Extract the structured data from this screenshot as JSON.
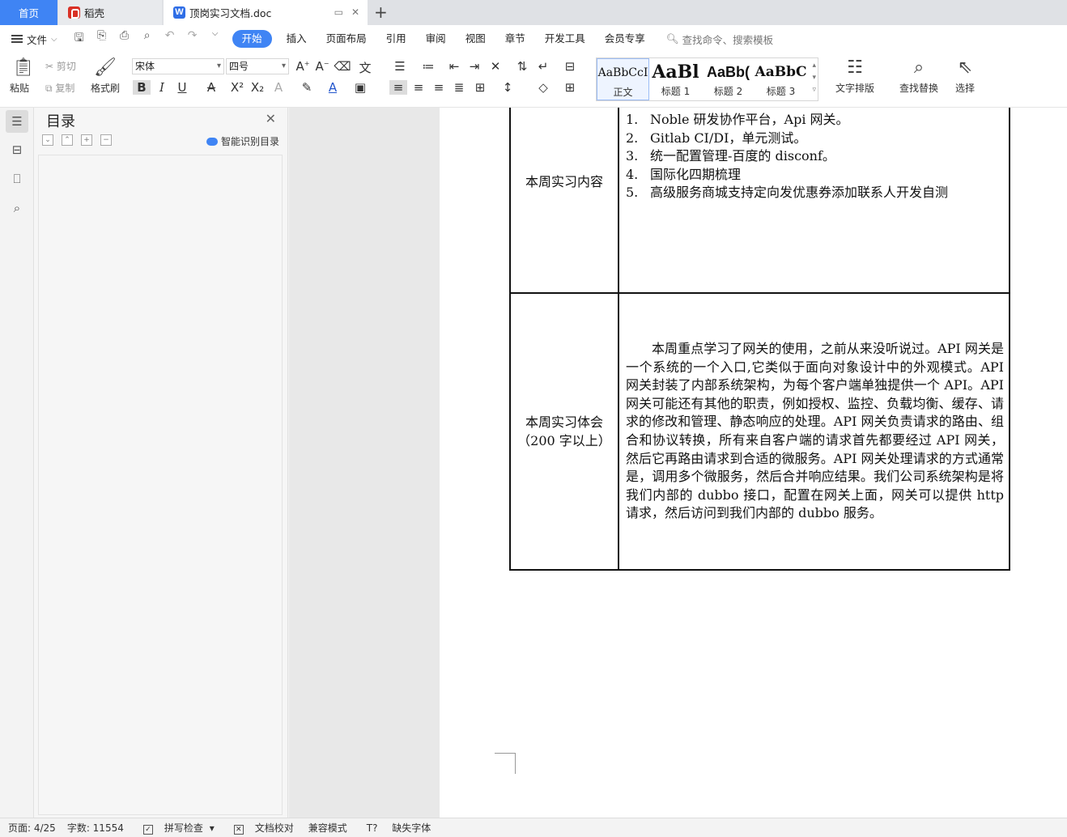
{
  "tabs": {
    "home": "首页",
    "daoke": "稻壳",
    "document": "顶岗实习文档.doc"
  },
  "menubar": {
    "file": "文件",
    "tabs": [
      "开始",
      "插入",
      "页面布局",
      "引用",
      "审阅",
      "视图",
      "章节",
      "开发工具",
      "会员专享"
    ],
    "search_placeholder": "查找命令、搜索模板"
  },
  "ribbon": {
    "paste": "粘贴",
    "cut": "剪切",
    "copy": "复制",
    "format_painter": "格式刷",
    "font_name": "宋体",
    "font_size": "四号",
    "styles": [
      {
        "sample": "AaBbCcI",
        "label": "正文"
      },
      {
        "sample": "AaBl",
        "label": "标题 1"
      },
      {
        "sample": "AaBb(",
        "label": "标题 2"
      },
      {
        "sample": "AaBbC",
        "label": "标题 3"
      }
    ],
    "text_layout": "文字排版",
    "find_replace": "查找替换",
    "select": "选择"
  },
  "toc": {
    "title": "目录",
    "smart_detect": "智能识别目录"
  },
  "document": {
    "row1_label": "本周实习内容",
    "plan_items": [
      {
        "num": "1.",
        "text": "Noble 研发协作平台，Api 网关。"
      },
      {
        "num": "2.",
        "text": "Gitlab CI/DI，单元测试。"
      },
      {
        "num": "3.",
        "text": "统一配置管理-百度的 disconf。"
      },
      {
        "num": "4.",
        "text": "国际化四期梳理"
      },
      {
        "num": "5.",
        "text": "高级服务商城支持定向发优惠券添加联系人开发自测"
      }
    ],
    "row2_label_line1": "本周实习体会",
    "row2_label_line2": "（200 字以上）",
    "essay": "本周重点学习了网关的使用，之前从来没听说过。API 网关是一个系统的一个入口,它类似于面向对象设计中的外观模式。API 网关封装了内部系统架构，为每个客户端单独提供一个 API。API 网关可能还有其他的职责，例如授权、监控、负载均衡、缓存、请求的修改和管理、静态响应的处理。API 网关负责请求的路由、组合和协议转换，所有来自客户端的请求首先都要经过 API 网关，然后它再路由请求到合适的微服务。API 网关处理请求的方式通常是，调用多个微服务，然后合并响应结果。我们公司系统架构是将我们内部的 dubbo 接口，配置在网关上面，网关可以提供 http 请求，然后访问到我们内部的 dubbo 服务。"
  },
  "status": {
    "page": "页面: 4/25",
    "word_count": "字数: 11554",
    "spell_check": "拼写检查",
    "doc_check": "文档校对",
    "compat_mode": "兼容模式",
    "missing_font": "缺失字体"
  }
}
